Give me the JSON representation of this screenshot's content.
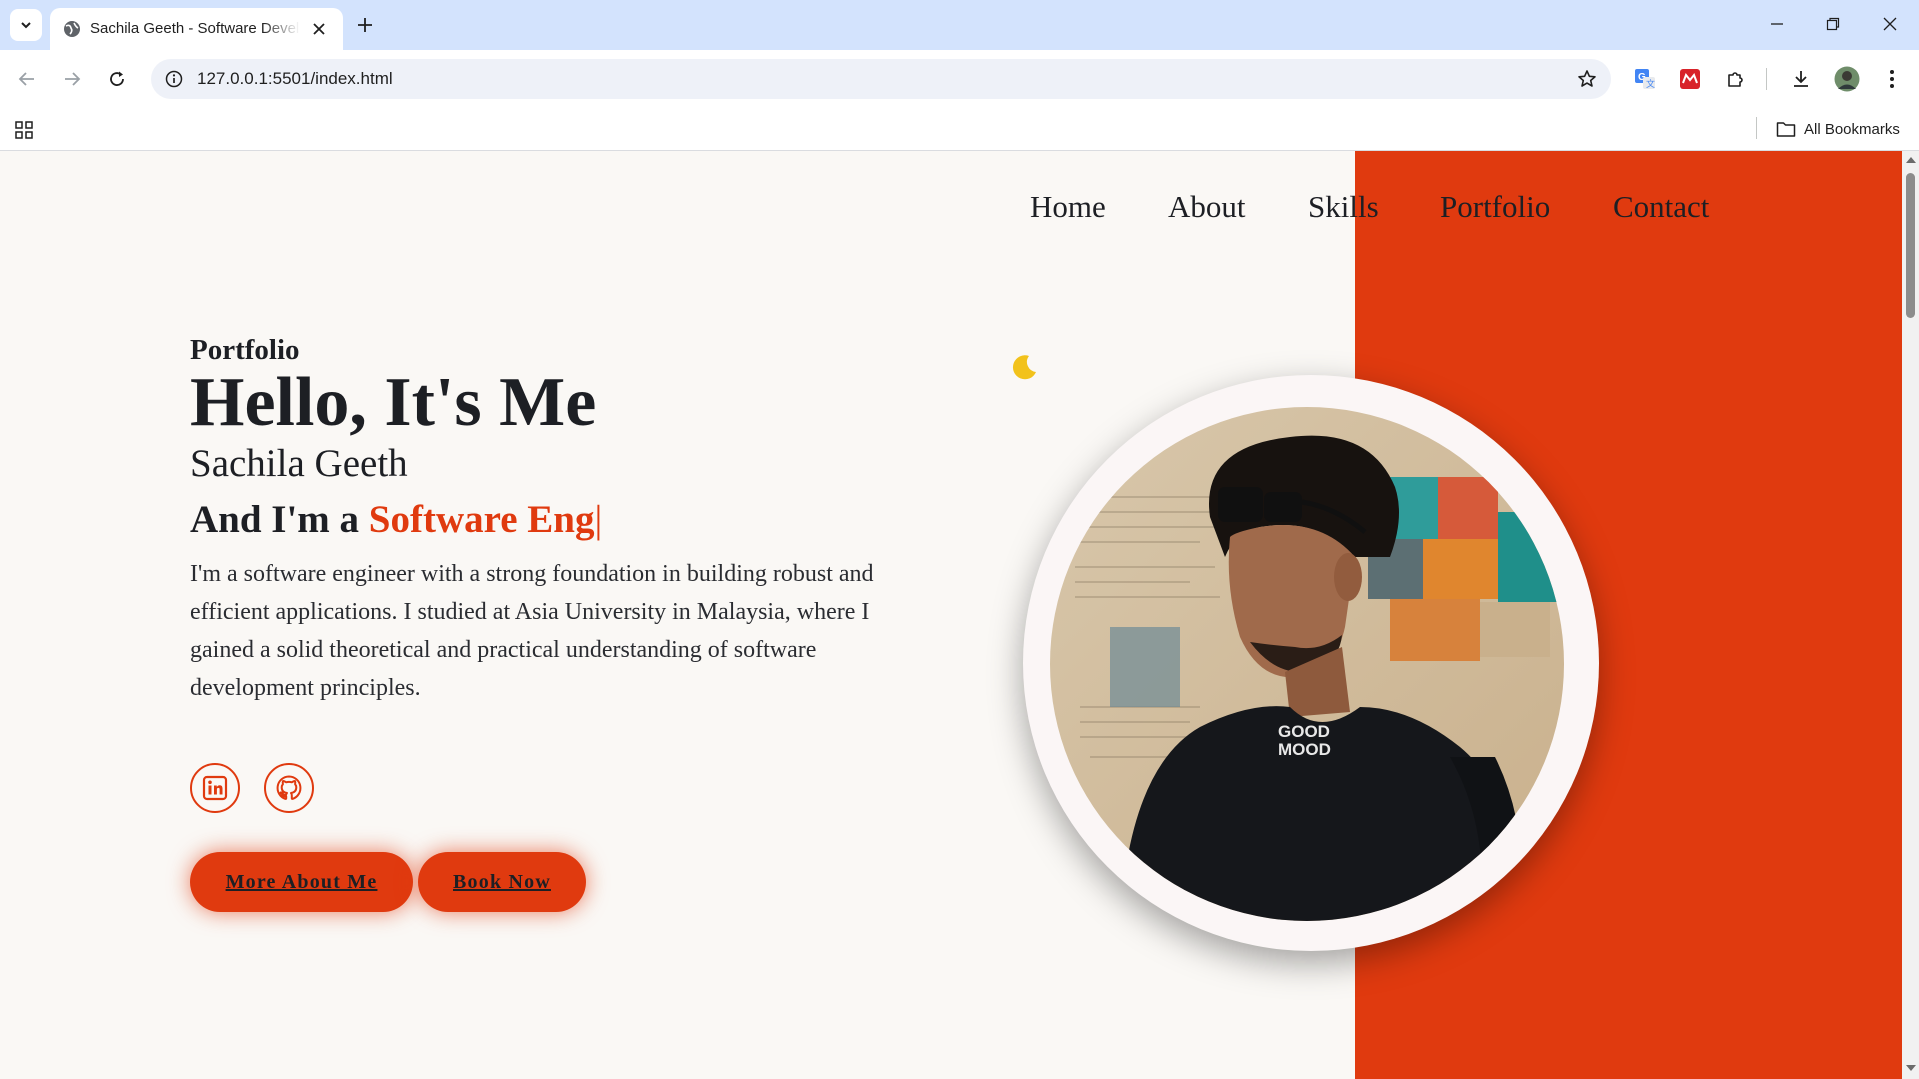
{
  "browser": {
    "tab": {
      "title": "Sachila Geeth - Software Developer",
      "favicon": "globe-icon"
    },
    "url": "127.0.0.1:5501/index.html",
    "bookmarks_bar": {
      "all_bookmarks_label": "All Bookmarks"
    },
    "toolbar_icons": [
      "back-icon",
      "forward-icon",
      "reload-icon",
      "site-info-icon",
      "bookmark-star-icon",
      "translate-extension-icon",
      "mendeley-extension-icon",
      "extensions-puzzle-icon",
      "download-icon",
      "profile-avatar",
      "menu-kebab-icon"
    ]
  },
  "page": {
    "colors": {
      "accent": "#e03a0f",
      "background": "#faf8f5",
      "text": "#1d1f24"
    },
    "nav": [
      {
        "label": "Home"
      },
      {
        "label": "About"
      },
      {
        "label": "Skills"
      },
      {
        "label": "Portfolio"
      },
      {
        "label": "Contact"
      }
    ],
    "hero": {
      "subtitle": "Portfolio",
      "title": "Hello, It's Me",
      "name": "Sachila Geeth",
      "role_prefix": "And I'm a ",
      "role_typed": "Software Eng",
      "caret": "|",
      "description": "I'm a software engineer with a strong foundation in building robust and efficient applications. I studied at Asia University in Malaysia, where I gained a solid theoretical and practical understanding of software development principles.",
      "social": [
        "linkedin-icon",
        "github-icon"
      ],
      "buttons": {
        "more_about": "More About Me",
        "book_now": "Book Now"
      },
      "theme_toggle": "moon-icon",
      "photo_shirt_text": [
        "GOOD",
        "MOOD"
      ]
    }
  }
}
